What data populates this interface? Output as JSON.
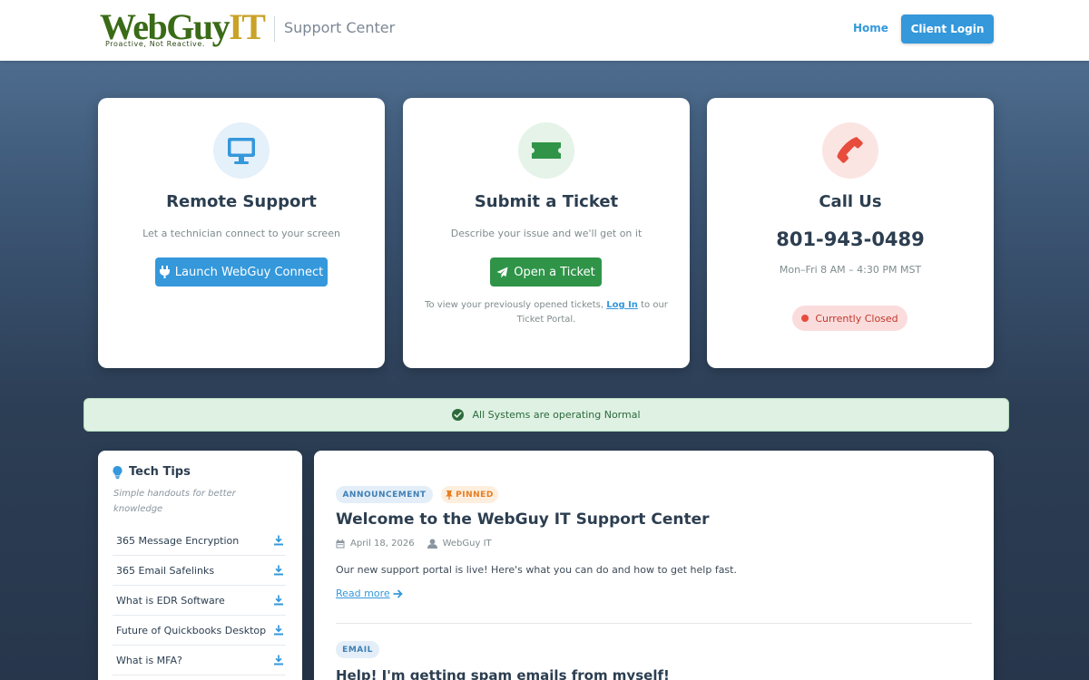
{
  "header": {
    "logo_web": "WebGuy",
    "logo_it": "IT",
    "logo_tagline": "Proactive, Not Reactive.",
    "subtitle": "Support Center",
    "nav_home": "Home",
    "client_login": "Client Login"
  },
  "cards": {
    "remote": {
      "icon": "monitor-icon",
      "title": "Remote Support",
      "desc": "Let a technician connect to your screen",
      "button": "Launch WebGuy Connect"
    },
    "ticket": {
      "icon": "ticket-icon",
      "title": "Submit a Ticket",
      "desc": "Describe your issue and we'll get on it",
      "button": "Open a Ticket",
      "note_before": "To view your previously opened tickets,",
      "note_link": "Log In",
      "note_after": "to our Ticket Portal."
    },
    "call": {
      "icon": "phone-icon",
      "title": "Call Us",
      "phone": "801-943-0489",
      "hours": "Mon–Fri 8 AM – 4:30 PM MST",
      "status": "Currently Closed"
    }
  },
  "status_bar": {
    "text": "All Systems are operating Normal"
  },
  "tech_tips": {
    "title": "Tech Tips",
    "subtitle": "Simple handouts for better knowledge",
    "items": [
      "365 Message Encryption",
      "365 Email Safelinks",
      "What is EDR Software",
      "Future of Quickbooks Desktop",
      "What is MFA?"
    ]
  },
  "posts": {
    "first": {
      "tag": "ANNOUNCEMENT",
      "pinned": "PINNED",
      "title": "Welcome to the WebGuy IT Support Center",
      "date": "April 18, 2026",
      "author": "WebGuy IT",
      "excerpt": "Our new support portal is live! Here's what you can do and how to get help fast.",
      "read_more": "Read more"
    },
    "second": {
      "tag": "EMAIL",
      "title": "Help! I'm getting spam emails from myself!"
    }
  },
  "colors": {
    "primary_blue": "#3498db",
    "success_green": "#2f9448",
    "danger_red": "#e74c3c",
    "logo_green": "#3a6b16",
    "logo_gold": "#c9a227"
  }
}
